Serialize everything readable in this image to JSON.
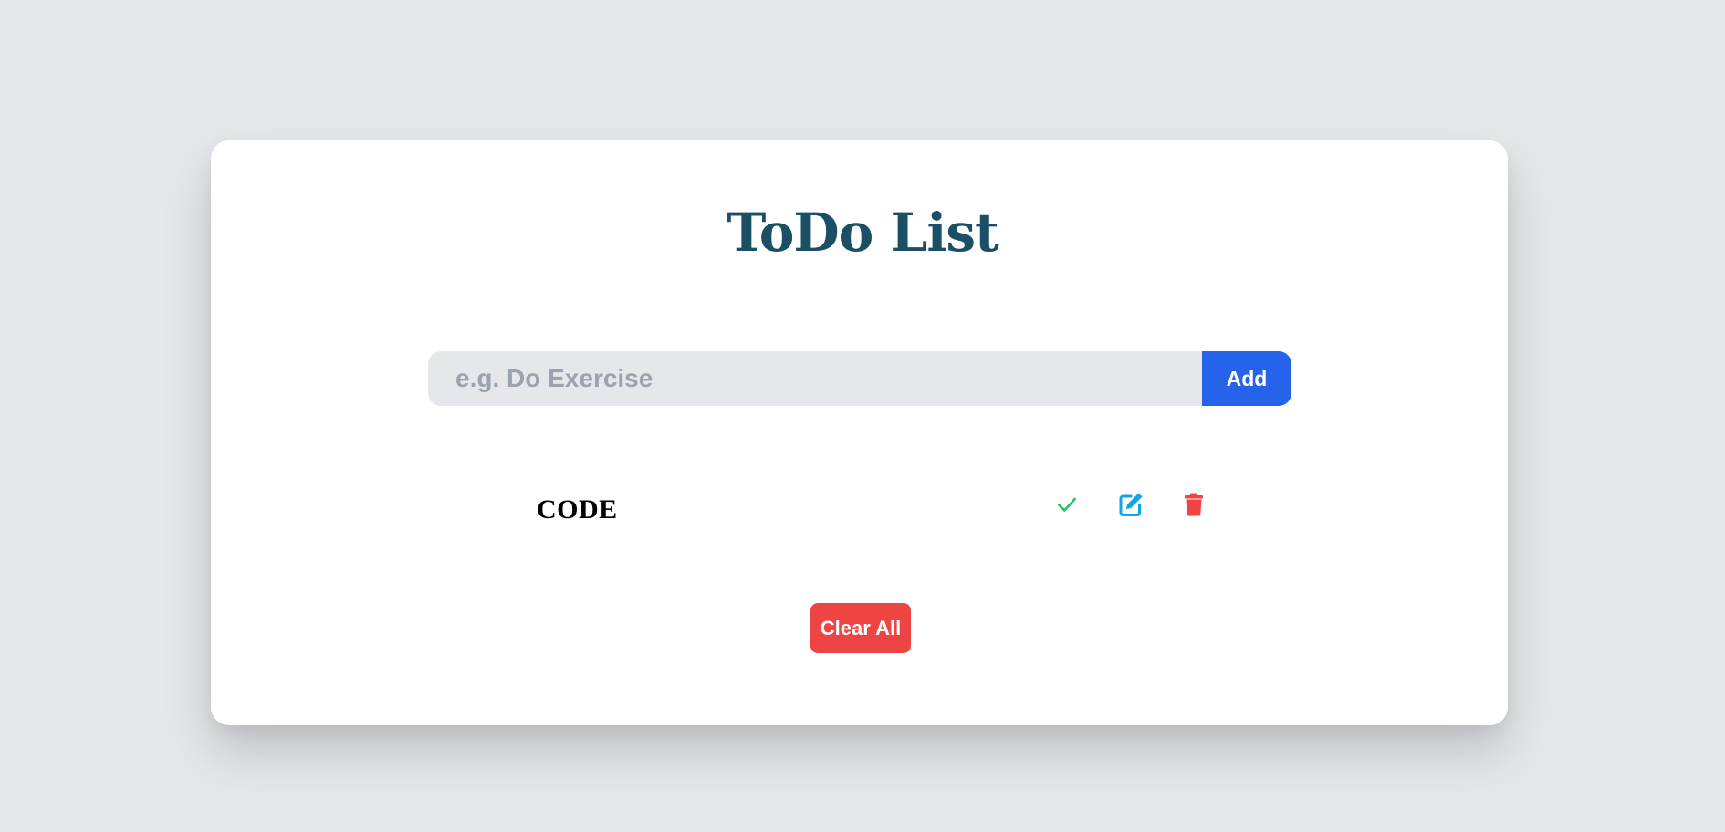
{
  "app": {
    "title": "ToDo List"
  },
  "input": {
    "placeholder": "e.g. Do Exercise",
    "value": "",
    "add_label": "Add"
  },
  "todos": [
    {
      "text": "CODE",
      "icons": {
        "complete": "check-icon",
        "edit": "edit-icon",
        "delete": "trash-icon"
      }
    }
  ],
  "actions": {
    "clear_label": "Clear All"
  },
  "colors": {
    "background": "#e5e7eb",
    "title": "#1b4f66",
    "add_button": "#2563eb",
    "check": "#22c55e",
    "edit": "#0ea5e9",
    "delete": "#ef4444"
  }
}
